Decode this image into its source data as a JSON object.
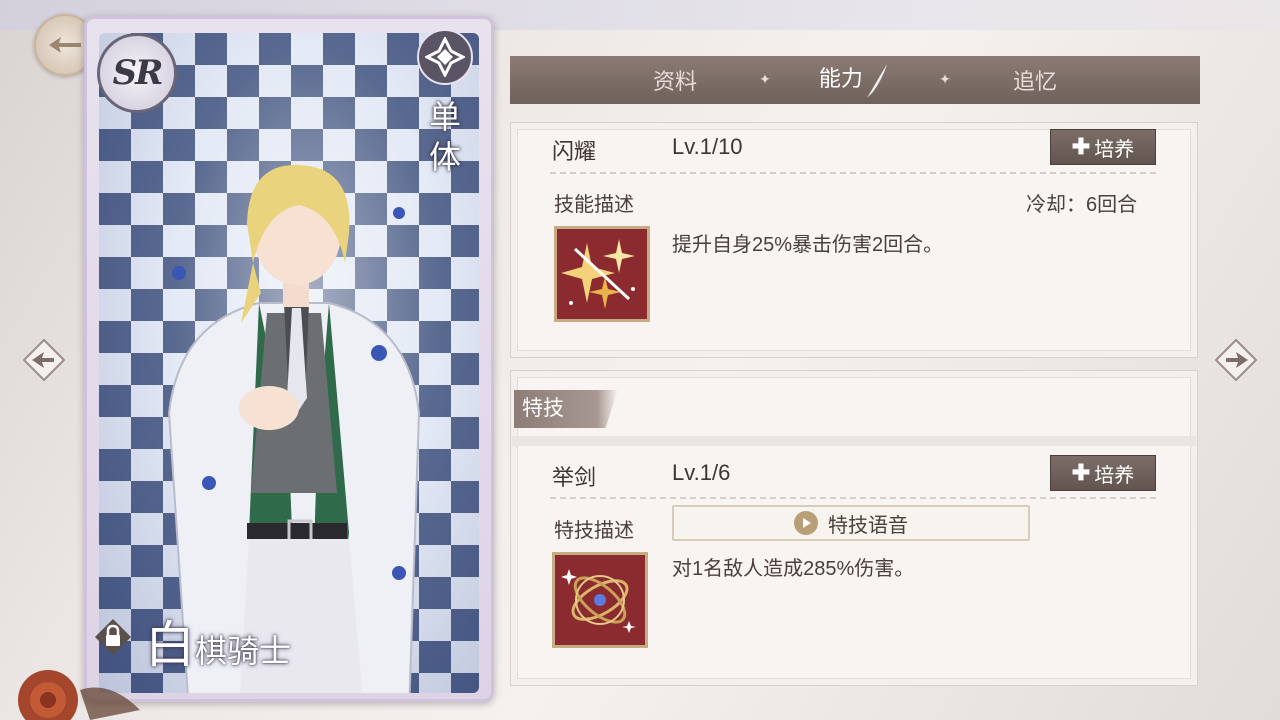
{
  "card": {
    "rarity": "SR",
    "target_type": "单体",
    "name_big": "白",
    "name_small": "棋骑士"
  },
  "tabs": [
    {
      "label": "资料",
      "active": false
    },
    {
      "label": "能力",
      "active": true
    },
    {
      "label": "追忆",
      "active": false
    }
  ],
  "skill": {
    "name": "闪耀",
    "level": "Lv.1/10",
    "train_label": "培养",
    "desc_label": "技能描述",
    "cooldown": "冷却：6回合",
    "description": "提升自身25%暴击伤害2回合。"
  },
  "special": {
    "section_label": "特技",
    "name": "举剑",
    "level": "Lv.1/6",
    "train_label": "培养",
    "desc_label": "特技描述",
    "voice_label": "特技语音",
    "description": "对1名敌人造成285%伤害。"
  },
  "icons": {
    "back": "back-icon",
    "nav_left": "arrow-left-icon",
    "nav_right": "arrow-right-icon",
    "lock": "lock-icon",
    "target": "single-target-icon",
    "play": "play-icon",
    "feather": "quill-icon"
  },
  "colors": {
    "tab_bar": "#7c6d67",
    "button": "#6f615b",
    "skill_icon_bg": "#8b2a2f",
    "icon_border": "#c7ab84"
  }
}
